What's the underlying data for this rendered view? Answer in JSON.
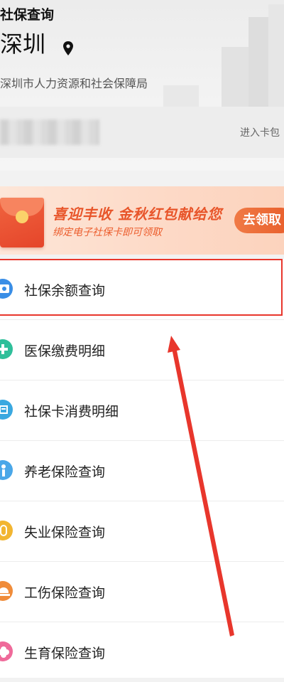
{
  "header": {
    "title": "社保查询",
    "city": "深圳",
    "bureau": "深圳市人力资源和社会保障局",
    "enter_card": "进入卡包"
  },
  "banner": {
    "title": "喜迎丰收 金秋红包献给您",
    "subtitle": "绑定电子社保卡即可领取",
    "button": "去领取"
  },
  "menu": [
    {
      "label": "社保余额查询",
      "icon": "id-card-icon",
      "color": "#3a8ee6"
    },
    {
      "label": "医保缴费明细",
      "icon": "medical-cross-icon",
      "color": "#2fbf9a"
    },
    {
      "label": "社保卡消费明细",
      "icon": "card-receipt-icon",
      "color": "#3aa8e0"
    },
    {
      "label": "养老保险查询",
      "icon": "elderly-person-icon",
      "color": "#4aa7e8"
    },
    {
      "label": "失业保险查询",
      "icon": "dollar-coin-icon",
      "color": "#f2b531"
    },
    {
      "label": "工伤保险查询",
      "icon": "helmet-icon",
      "color": "#f08c3a"
    },
    {
      "label": "生育保险查询",
      "icon": "flower-icon",
      "color": "#ef6a9a"
    }
  ],
  "colors": {
    "annotation_red": "#e8362c",
    "banner_orange": "#e8552a"
  }
}
